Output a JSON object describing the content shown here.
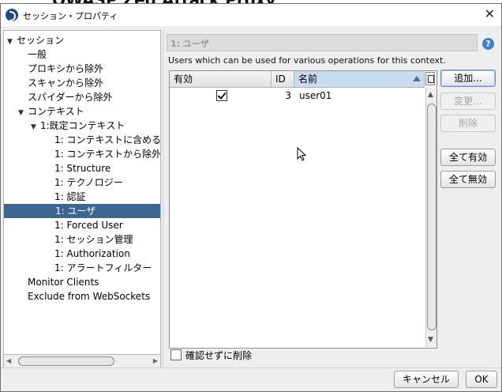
{
  "background_title": "OWASP Zed Attack Proxy",
  "window": {
    "title": "セッション・プロパティ",
    "close_glyph": "✕"
  },
  "tree": {
    "items": [
      {
        "label": "セッション",
        "toggle": "▼",
        "level": 0
      },
      {
        "label": "一般",
        "toggle": "",
        "level": 1
      },
      {
        "label": "プロキシから除外",
        "toggle": "",
        "level": 1
      },
      {
        "label": "スキャンから除外",
        "toggle": "",
        "level": 1
      },
      {
        "label": "スパイダーから除外",
        "toggle": "",
        "level": 1
      },
      {
        "label": "コンテキスト",
        "toggle": "▼",
        "level": 1
      },
      {
        "label": "1:既定コンテキスト",
        "toggle": "▼",
        "level": 2
      },
      {
        "label": "1: コンテキストに含める",
        "toggle": "",
        "level": 3
      },
      {
        "label": "1: コンテキストから除外",
        "toggle": "",
        "level": 3
      },
      {
        "label": "1: Structure",
        "toggle": "",
        "level": 3
      },
      {
        "label": "1: テクノロジー",
        "toggle": "",
        "level": 3
      },
      {
        "label": "1: 認証",
        "toggle": "",
        "level": 3
      },
      {
        "label": "1: ユーザ",
        "toggle": "",
        "level": 3,
        "selected": true
      },
      {
        "label": "1: Forced User",
        "toggle": "",
        "level": 3
      },
      {
        "label": "1: セッション管理",
        "toggle": "",
        "level": 3
      },
      {
        "label": "1: Authorization",
        "toggle": "",
        "level": 3
      },
      {
        "label": "1: アラートフィルター",
        "toggle": "",
        "level": 3
      },
      {
        "label": "Monitor Clients",
        "toggle": "",
        "level": 1
      },
      {
        "label": "Exclude from WebSockets",
        "toggle": "",
        "level": 1
      }
    ]
  },
  "panel": {
    "header": "1: ユーザ",
    "help_glyph": "?",
    "description": "Users which can be used for various operations for this context."
  },
  "table": {
    "columns": {
      "enabled": "有効",
      "id": "ID",
      "name": "名前"
    },
    "rows": [
      {
        "enabled": true,
        "id": "3",
        "name": "user01"
      }
    ]
  },
  "buttons": {
    "add": "追加...",
    "modify": "変更...",
    "remove": "削除",
    "enable_all": "全て有効",
    "disable_all": "全て無効",
    "cancel": "キャンセル",
    "ok": "OK"
  },
  "remove_without_confirm": {
    "label": "確認せずに削除",
    "checked": false
  }
}
